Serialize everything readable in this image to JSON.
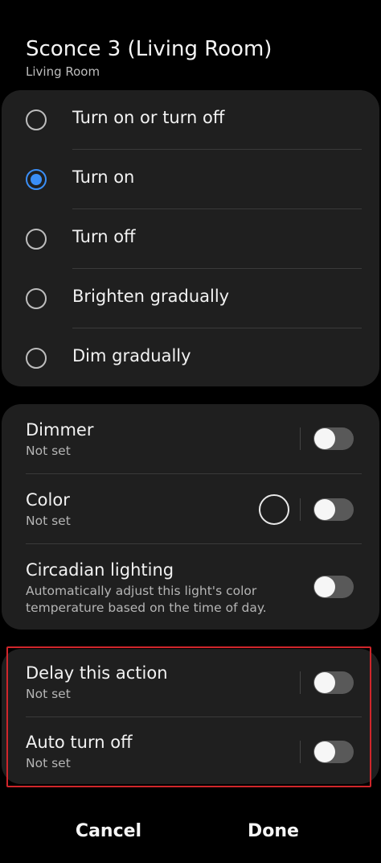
{
  "header": {
    "title": "Sconce 3 (Living Room)",
    "subtitle": "Living Room"
  },
  "actions": [
    {
      "label": "Turn on or turn off",
      "selected": false
    },
    {
      "label": "Turn on",
      "selected": true
    },
    {
      "label": "Turn off",
      "selected": false
    },
    {
      "label": "Brighten gradually",
      "selected": false
    },
    {
      "label": "Dim gradually",
      "selected": false
    }
  ],
  "settings": {
    "dimmer": {
      "title": "Dimmer",
      "value": "Not set",
      "enabled": false
    },
    "color": {
      "title": "Color",
      "value": "Not set",
      "enabled": false
    },
    "circadian": {
      "title": "Circadian lighting",
      "description": "Automatically adjust this light's color temperature based on the time of day.",
      "enabled": false
    }
  },
  "delay": {
    "delay_action": {
      "title": "Delay this action",
      "value": "Not set",
      "enabled": false
    },
    "auto_off": {
      "title": "Auto turn off",
      "value": "Not set",
      "enabled": false
    }
  },
  "footer": {
    "cancel_label": "Cancel",
    "done_label": "Done"
  },
  "colors": {
    "accent": "#3a8ef6",
    "highlight": "#d0262b",
    "card": "#1f1f1f"
  }
}
